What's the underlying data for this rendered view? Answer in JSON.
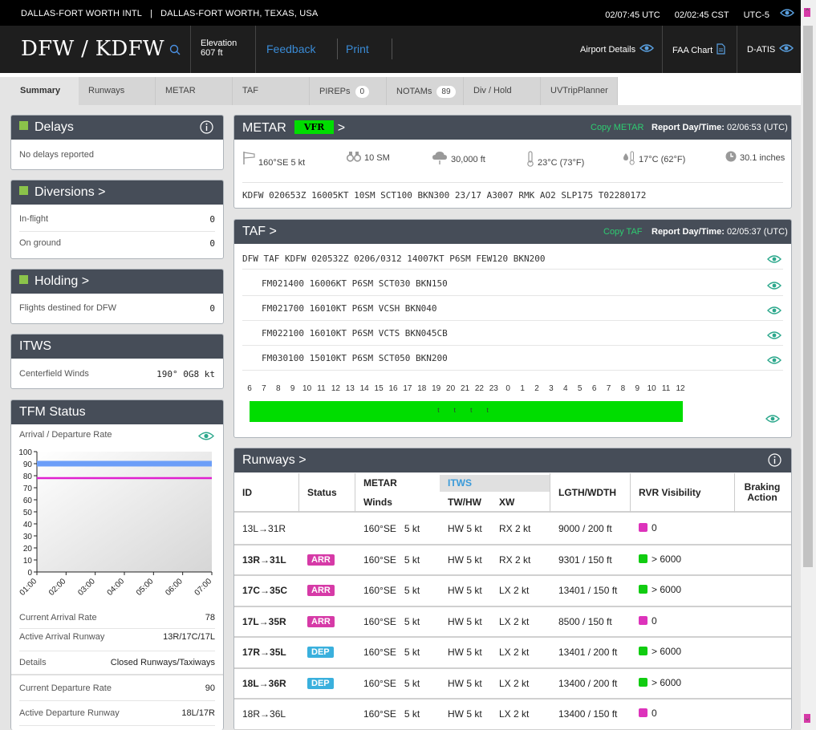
{
  "topbar": {
    "airport_name": "DALLAS-FORT WORTH INTL",
    "separator": "|",
    "city": "DALLAS-FORT WORTH, TEXAS, USA",
    "utc_time": "02/07:45 UTC",
    "local_time": "02/02:45 CST",
    "utc_offset": "UTC-5"
  },
  "header": {
    "code": "DFW / KDFW",
    "elevation_label": "Elevation",
    "elevation_value": "607 ft",
    "feedback": "Feedback",
    "print": "Print",
    "airport_details": "Airport Details",
    "faa_chart": "FAA Chart",
    "datis": "D-ATIS"
  },
  "tabs": [
    {
      "label": "Summary"
    },
    {
      "label": "Runways"
    },
    {
      "label": "METAR"
    },
    {
      "label": "TAF"
    },
    {
      "label": "PIREPs",
      "count": "0"
    },
    {
      "label": "NOTAMs",
      "count": "89"
    },
    {
      "label": "Div / Hold"
    },
    {
      "label": "UVTripPlanner"
    }
  ],
  "delays": {
    "title": "Delays",
    "text": "No delays reported"
  },
  "diversions": {
    "title": "Diversions >",
    "rows": [
      {
        "label": "In-flight",
        "value": "0"
      },
      {
        "label": "On ground",
        "value": "0"
      }
    ]
  },
  "holding": {
    "title": "Holding >",
    "rows": [
      {
        "label": "Flights destined for DFW",
        "value": "0"
      }
    ]
  },
  "itws": {
    "title": "ITWS",
    "label": "Centerfield Winds",
    "value": "190° 0G8 kt"
  },
  "tfm": {
    "title": "TFM Status",
    "chart_title": "Arrival / Departure Rate",
    "rows": [
      {
        "label": "Current Arrival Rate",
        "value": "78"
      },
      {
        "label": "Active Arrival Runway",
        "value": "13R/17C/17L"
      },
      {
        "label": "Details",
        "value": "Closed Runways/Taxiways"
      },
      {
        "label": "Current Departure Rate",
        "value": "90"
      },
      {
        "label": "Active Departure Runway",
        "value": "18L/17R"
      }
    ]
  },
  "chart_data": {
    "type": "line",
    "title": "Arrival / Departure Rate",
    "x": [
      "01:00",
      "02:00",
      "03:00",
      "04:00",
      "05:00",
      "06:00",
      "07:00"
    ],
    "series": [
      {
        "values": [
          90,
          90,
          90,
          90,
          90,
          90,
          90
        ],
        "color": "#6c9ef8"
      },
      {
        "values": [
          78,
          78,
          78,
          78,
          78,
          78,
          78
        ],
        "color": "#e020d0"
      }
    ],
    "ylim": [
      0,
      100
    ],
    "yticks": [
      0,
      10,
      20,
      30,
      40,
      50,
      60,
      70,
      80,
      90,
      100
    ]
  },
  "metar": {
    "title": "METAR",
    "category": "VFR",
    "arrow": ">",
    "copy": "Copy METAR",
    "report_label": "Report Day/Time:",
    "report_value": "02/06:53 (UTC)",
    "wind": "160°SE 5 kt",
    "visibility": "10 SM",
    "ceiling": "30,000 ft",
    "temp": "23°C (73°F)",
    "dewpoint": "17°C (62°F)",
    "altimeter": "30.1 inches",
    "raw": "KDFW 020653Z 16005KT 10SM SCT100 BKN300 23/17 A3007 RMK AO2 SLP175 T02280172"
  },
  "taf": {
    "title": "TAF >",
    "copy": "Copy TAF",
    "report_label": "Report Day/Time:",
    "report_value": "02/05:37 (UTC)",
    "lines": [
      "DFW TAF KDFW 020532Z 0206/0312 14007KT P6SM FEW120 BKN200",
      "FM021400 16006KT P6SM SCT030 BKN150",
      "FM021700 16010KT P6SM VCSH BKN040",
      "FM022100 16010KT P6SM VCTS BKN045CB",
      "FM030100 15010KT P6SM SCT050 BKN200"
    ],
    "hours": [
      "6",
      "7",
      "8",
      "9",
      "10",
      "11",
      "12",
      "13",
      "14",
      "15",
      "16",
      "17",
      "18",
      "19",
      "20",
      "21",
      "22",
      "23",
      "0",
      "1",
      "2",
      "3",
      "4",
      "5",
      "6",
      "7",
      "8",
      "9",
      "10",
      "11",
      "12"
    ],
    "bar_text": "t t t t"
  },
  "runways": {
    "title": "Runways >",
    "headers": {
      "id": "ID",
      "status": "Status",
      "metar": "METAR",
      "winds": "Winds",
      "itws": "ITWS",
      "twhw": "TW/HW",
      "xw": "XW",
      "lw": "LGTH/WDTH",
      "rvr": "RVR Visibility",
      "braking": "Braking Action"
    },
    "rows": [
      {
        "id": "13L→31R",
        "bold": false,
        "status": "",
        "wind": "160°SE   5 kt",
        "tw": "HW 5 kt",
        "xw": "RX 2 kt",
        "lw": "9000 / 200 ft",
        "rvr_color": "#dd33bb",
        "rvr": "0"
      },
      {
        "id": "13R→31L",
        "bold": true,
        "status": "ARR",
        "wind": "160°SE   5 kt",
        "tw": "HW 5 kt",
        "xw": "RX 2 kt",
        "lw": "9301 / 150 ft",
        "rvr_color": "#11cc11",
        "rvr": "> 6000"
      },
      {
        "id": "17C→35C",
        "bold": true,
        "status": "ARR",
        "wind": "160°SE   5 kt",
        "tw": "HW 5 kt",
        "xw": "LX 2 kt",
        "lw": "13401 / 150 ft",
        "rvr_color": "#11cc11",
        "rvr": "> 6000"
      },
      {
        "id": "17L→35R",
        "bold": true,
        "status": "ARR",
        "wind": "160°SE   5 kt",
        "tw": "HW 5 kt",
        "xw": "LX 2 kt",
        "lw": "8500 / 150 ft",
        "rvr_color": "#dd33bb",
        "rvr": "0"
      },
      {
        "id": "17R→35L",
        "bold": true,
        "status": "DEP",
        "wind": "160°SE   5 kt",
        "tw": "HW 5 kt",
        "xw": "LX 2 kt",
        "lw": "13401 / 200 ft",
        "rvr_color": "#11cc11",
        "rvr": "> 6000"
      },
      {
        "id": "18L→36R",
        "bold": true,
        "status": "DEP",
        "wind": "160°SE   5 kt",
        "tw": "HW 5 kt",
        "xw": "LX 2 kt",
        "lw": "13400 / 200 ft",
        "rvr_color": "#11cc11",
        "rvr": "> 6000"
      },
      {
        "id": "18R→36L",
        "bold": false,
        "status": "",
        "wind": "160°SE   5 kt",
        "tw": "HW 5 kt",
        "xw": "LX 2 kt",
        "lw": "13400 / 150 ft",
        "rvr_color": "#dd33bb",
        "rvr": "0"
      }
    ]
  }
}
